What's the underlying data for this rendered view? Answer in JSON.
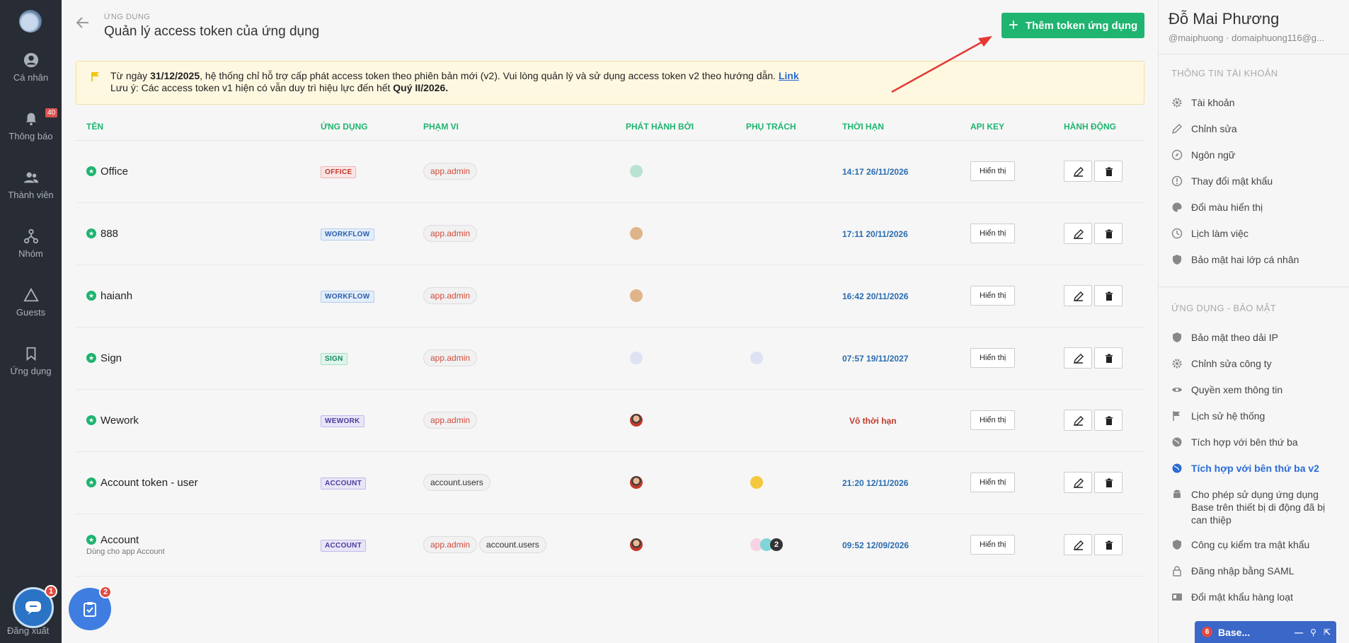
{
  "nav": {
    "items": [
      {
        "label": "Cá nhân",
        "icon": "user-icon"
      },
      {
        "label": "Thông báo",
        "icon": "bell-icon",
        "badge": "40"
      },
      {
        "label": "Thành viên",
        "icon": "members-icon"
      },
      {
        "label": "Nhóm",
        "icon": "group-icon"
      },
      {
        "label": "Guests",
        "icon": "guests-icon"
      },
      {
        "label": "Ứng dụng",
        "icon": "bookmark-icon"
      }
    ],
    "logout": "Đăng xuất"
  },
  "header": {
    "breadcrumb": "ỨNG DỤNG",
    "title": "Quản lý access token của ứng dụng",
    "add_button": "Thêm token ứng dụng"
  },
  "notice": {
    "p1": "Từ ngày ",
    "date": "31/12/2025",
    "p2": ", hệ thống chỉ hỗ trợ cấp phát access token theo phiên bản mới (v2). Vui lòng quản lý và sử dụng access token v2 theo hướng dẫn. ",
    "link": "Link",
    "p3": "Lưu ý: Các access token v1 hiện có vẫn duy trì hiệu lực đến hết ",
    "deadline": "Quý II/2026."
  },
  "table": {
    "columns": [
      "TÊN",
      "ỨNG DỤNG",
      "PHẠM VI",
      "PHÁT HÀNH BỞI",
      "PHỤ TRÁCH",
      "THỜI HẠN",
      "API KEY",
      "HÀNH ĐỘNG"
    ],
    "show_label": "Hiển thị",
    "rows": [
      {
        "name": "Office",
        "app": "OFFICE",
        "scopes": [
          "app.admin"
        ],
        "expiry": "14:17 26/11/2026"
      },
      {
        "name": "888",
        "app": "WORKFLOW",
        "scopes": [
          "app.admin"
        ],
        "expiry": "17:11 20/11/2026"
      },
      {
        "name": "haianh",
        "app": "WORKFLOW",
        "scopes": [
          "app.admin"
        ],
        "expiry": "16:42 20/11/2026"
      },
      {
        "name": "Sign",
        "app": "SIGN",
        "scopes": [
          "app.admin"
        ],
        "expiry": "07:57 19/11/2027"
      },
      {
        "name": "Wework",
        "app": "WEWORK",
        "scopes": [
          "app.admin"
        ],
        "expiry": "Vô thời hạn"
      },
      {
        "name": "Account token - user",
        "app": "ACCOUNT",
        "scopes": [
          "account.users"
        ],
        "expiry": "21:20 12/11/2026"
      },
      {
        "name": "Account",
        "sub": "Dùng cho app Account",
        "app": "ACCOUNT",
        "scopes": [
          "app.admin",
          "account.users"
        ],
        "expiry": "09:52 12/09/2026",
        "more": "2"
      }
    ]
  },
  "profile": {
    "name": "Đỗ Mai Phương",
    "handle": "@maiphuong",
    "email": "domaiphuong116@g...",
    "section1": "THÔNG TIN TÀI KHOẢN",
    "items1": [
      "Tài khoản",
      "Chỉnh sửa",
      "Ngôn ngữ",
      "Thay đổi mật khẩu",
      "Đổi màu hiển thị",
      "Lịch làm việc",
      "Bảo mật hai lớp cá nhân"
    ],
    "section2": "ỨNG DỤNG - BẢO MẬT",
    "items2": [
      "Bảo mật theo dải IP",
      "Chỉnh sửa công ty",
      "Quyền xem thông tin",
      "Lịch sử hệ thống",
      "Tích hợp với bên thứ ba",
      "Tích hợp với bên thứ ba v2",
      "Cho phép sử dụng ứng dụng Base trên thiết bị di động đã bị can thiệp",
      "Công cụ kiểm tra mật khẩu",
      "Đăng nhập bằng SAML",
      "Đổi mật khẩu hàng loạt"
    ]
  },
  "basebar": {
    "count": "6",
    "label": "Base..."
  },
  "fab": {
    "chat_badge": "1",
    "task_badge": "2"
  },
  "colors": {
    "accent": "#1fb470",
    "link": "#2b6cd4",
    "nav_bg": "#282c34"
  }
}
